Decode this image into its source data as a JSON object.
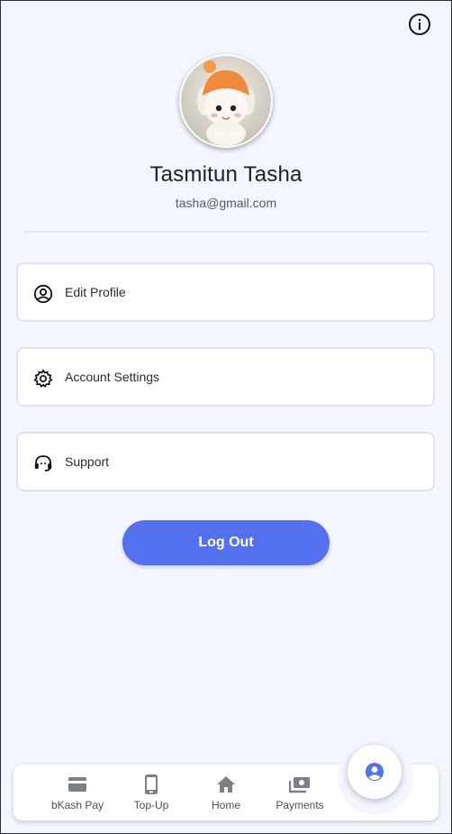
{
  "profile": {
    "name": "Tasmitun Tasha",
    "email": "tasha@gmail.com"
  },
  "menu": [
    {
      "label": "Edit Profile",
      "icon": "user-circle-icon"
    },
    {
      "label": "Account Settings",
      "icon": "gear-icon"
    },
    {
      "label": "Support",
      "icon": "headset-icon"
    }
  ],
  "logout_label": "Log Out",
  "bottom_nav": [
    {
      "label": "bKash Pay",
      "icon": "card-icon"
    },
    {
      "label": "Top-Up",
      "icon": "phone-icon"
    },
    {
      "label": "Home",
      "icon": "home-icon"
    },
    {
      "label": "Payments",
      "icon": "payments-icon"
    }
  ],
  "active_tab_icon": "account-icon",
  "colors": {
    "background": "#f3f6ff",
    "accent": "#5370ef",
    "card_border": "#dfe3ee"
  }
}
